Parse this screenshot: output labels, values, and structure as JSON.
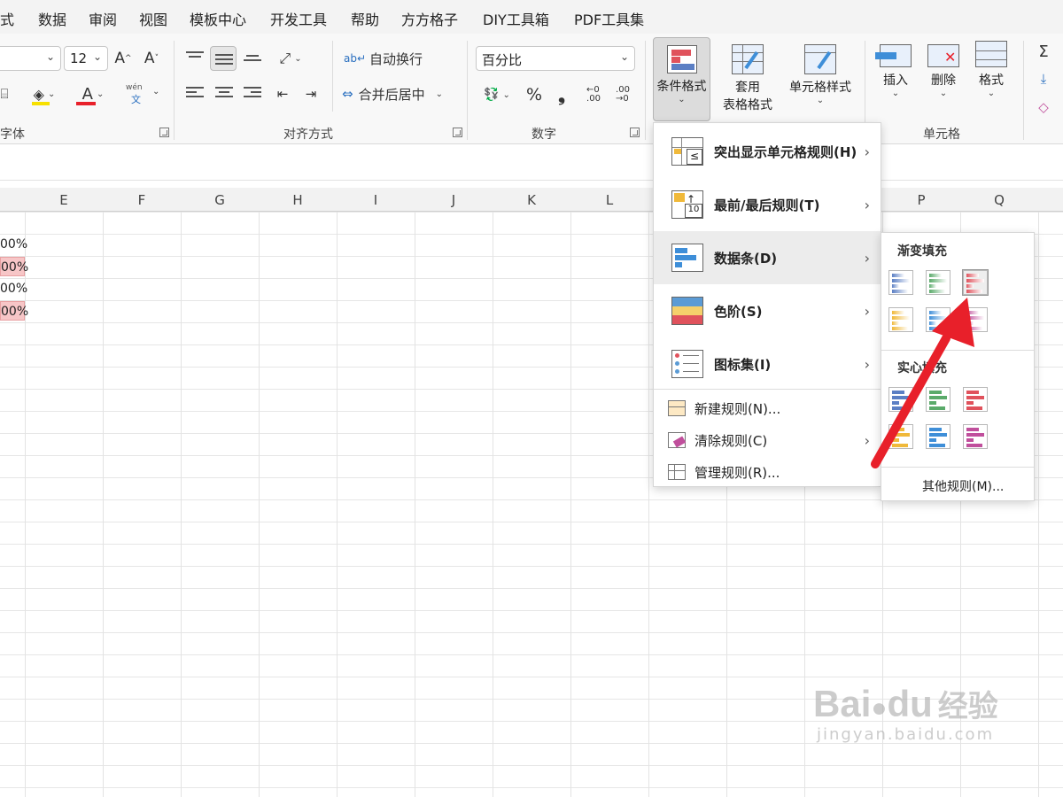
{
  "menubar": {
    "items": [
      "式",
      "数据",
      "审阅",
      "视图",
      "模板中心",
      "开发工具",
      "帮助",
      "方方格子",
      "DIY工具箱",
      "PDF工具集"
    ]
  },
  "ribbon": {
    "font_size": "12",
    "font_group_label": "字体",
    "align_group_label": "对齐方式",
    "number_group_label": "数字",
    "cells_group_label": "单元格",
    "wrap_text": "自动换行",
    "merge_center": "合并后居中",
    "number_format": "百分比",
    "phonetic_top": "wén",
    "phonetic_bottom": "文",
    "percent_symbol": "%",
    "comma_symbol": "❟",
    "conditional_format": "条件格式",
    "table_format_1": "套用",
    "table_format_2": "表格格式",
    "cell_styles": "单元格样式",
    "insert": "插入",
    "delete": "删除",
    "format": "格式",
    "sum_symbol": "Σ"
  },
  "grid": {
    "columns": [
      "E",
      "F",
      "G",
      "H",
      "I",
      "J",
      "K",
      "L",
      "P",
      "Q"
    ],
    "partial_values": [
      "00%",
      "00%",
      "00%",
      "00%"
    ]
  },
  "cf_menu": {
    "items": [
      {
        "label": "突出显示单元格规则(H)",
        "icon": "highlight-rules-icon"
      },
      {
        "label": "最前/最后规则(T)",
        "icon": "top-bottom-rules-icon"
      },
      {
        "label": "数据条(D)",
        "icon": "data-bars-icon"
      },
      {
        "label": "色阶(S)",
        "icon": "color-scales-icon"
      },
      {
        "label": "图标集(I)",
        "icon": "icon-sets-icon"
      }
    ],
    "small_items": [
      {
        "label": "新建规则(N)...",
        "icon": "new-rule-icon"
      },
      {
        "label": "清除规则(C)",
        "icon": "clear-rules-icon"
      },
      {
        "label": "管理规则(R)...",
        "icon": "manage-rules-icon"
      }
    ]
  },
  "databar_submenu": {
    "gradient_title": "渐变填充",
    "solid_title": "实心填充",
    "more_rules": "其他规则(M)...",
    "gradient_colors": [
      "#5b7fc4",
      "#5aaa6a",
      "#e0525c",
      "#f0b93a",
      "#3e8ed8",
      "#c04f9c"
    ],
    "solid_colors": [
      "#5b7fc4",
      "#5aaa6a",
      "#e0525c",
      "#f0b93a",
      "#3e8ed8",
      "#c04f9c"
    ]
  },
  "watermark": {
    "brand": "Bai",
    "brand_du": "du",
    "brand_cn": "经验",
    "url": "jingyan.baidu.com"
  },
  "colors": {
    "accent_red": "#e8202a",
    "highlight_pink": "#f7c6c7"
  }
}
